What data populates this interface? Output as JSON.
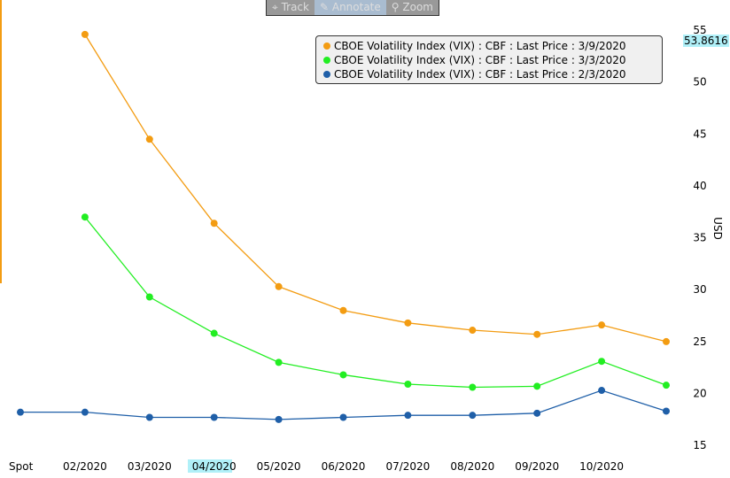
{
  "toolbar": {
    "items": [
      {
        "label": "Track",
        "icon": "crosshair-icon"
      },
      {
        "label": "Annotate",
        "icon": "pencil-icon"
      },
      {
        "label": "Zoom",
        "icon": "magnifier-icon"
      }
    ]
  },
  "crosshair_value": "53.8616",
  "chart_data": {
    "type": "line",
    "ylabel": "USD",
    "ylim": [
      15,
      55
    ],
    "yticks": [
      15,
      20,
      25,
      30,
      35,
      40,
      45,
      50,
      55
    ],
    "categories": [
      "Spot",
      "02/2020",
      "03/2020",
      "04/2020",
      "05/2020",
      "06/2020",
      "07/2020",
      "08/2020",
      "09/2020",
      "10/2020",
      ""
    ],
    "highlighted_category": "04/2020",
    "legend_placement": "top-right",
    "grid": false,
    "series": [
      {
        "name": "CBOE Volatility Index (VIX) : CBF : Last Price : 3/9/2020",
        "color": "#f39c12",
        "values": [
          null,
          54.5,
          44.4,
          36.3,
          30.2,
          27.9,
          26.7,
          26.0,
          25.6,
          26.5,
          24.9
        ]
      },
      {
        "name": "CBOE Volatility Index (VIX) : CBF : Last Price : 3/3/2020",
        "color": "#22ee22",
        "values": [
          null,
          36.9,
          29.2,
          25.7,
          22.9,
          21.7,
          20.8,
          20.5,
          20.6,
          23.0,
          20.7
        ]
      },
      {
        "name": "CBOE Volatility Index (VIX) : CBF : Last Price : 2/3/2020",
        "color": "#1f5fa8",
        "values": [
          18.1,
          18.1,
          17.6,
          17.6,
          17.4,
          17.6,
          17.8,
          17.8,
          18.0,
          20.2,
          18.2
        ]
      }
    ]
  }
}
